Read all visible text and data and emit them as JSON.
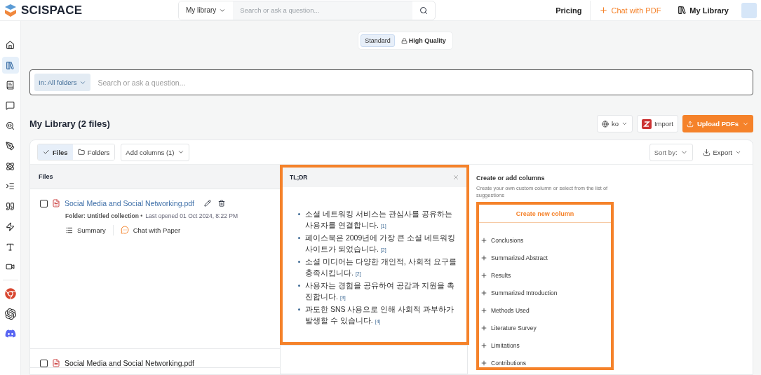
{
  "header": {
    "brand": "SCISPACE",
    "scope": "My library",
    "search_placeholder": "Search or ask a question...",
    "links": [
      {
        "label": "Pricing",
        "kind": "plain"
      },
      {
        "label": "Chat with PDF",
        "kind": "accent"
      },
      {
        "label": "My Library",
        "kind": "library"
      }
    ]
  },
  "sidebar": {
    "items": [
      {
        "selected": false
      },
      {
        "selected": true
      },
      {
        "selected": false
      },
      {
        "selected": false
      },
      {
        "selected": false
      },
      {
        "selected": false
      },
      {
        "selected": false
      },
      {
        "selected": false
      },
      {
        "selected": false
      },
      {
        "selected": false
      },
      {
        "selected": false
      },
      {
        "selected": false
      }
    ]
  },
  "modes": [
    {
      "label": "Standard",
      "selected": true,
      "locked": false
    },
    {
      "label": "High Quality",
      "selected": false,
      "locked": true
    }
  ],
  "library_search": {
    "scope_label": "In:",
    "scope": "All folders",
    "placeholder": "Search or ask a question..."
  },
  "title": "My Library (2 files)",
  "actions": {
    "language": "ko",
    "import": "Import",
    "upload": "Upload PDFs"
  },
  "toolbar": {
    "tabs": [
      {
        "label": "Files",
        "selected": true
      },
      {
        "label": "Folders",
        "selected": false
      }
    ],
    "add_columns": "Add columns (1)",
    "sort": "Sort by:",
    "export": "Export"
  },
  "table": {
    "columns": [
      "Files",
      "TL;DR"
    ],
    "tldr_highlighted": true,
    "rows": [
      {
        "file": "Social Media and Social Networking.pdf",
        "checked": false,
        "hovered": true,
        "folder": "Folder: Untitled collection •",
        "opened": "Last opened 01 Oct 2024, 8:22 PM",
        "actions": [
          "Summary",
          "Chat with Paper"
        ],
        "tldr": [
          {
            "text": "소셜 네트워킹 서비스는 관심사를 공유하는 사용자를 연결합니다.",
            "ref": "[1]"
          },
          {
            "text": "페이스북은 2009년에 가장 큰 소셜 네트워킹 사이트가 되었습니다.",
            "ref": "[2]"
          },
          {
            "text": "소셜 미디어는 다양한 개인적, 사회적 요구를 충족시킵니다.",
            "ref": "[2]"
          },
          {
            "text": "사용자는 경험을 공유하여 공감과 지원을 촉진합니다.",
            "ref": "[3]"
          },
          {
            "text": "과도한 SNS 사용으로 인해 사회적 과부하가 발생할 수 있습니다.",
            "ref": "[4]"
          }
        ]
      },
      {
        "file": "Social Media and Social Networking.pdf",
        "checked": false,
        "hovered": false
      }
    ]
  },
  "columns_panel": {
    "title": "Create or add columns",
    "hint": "Create your own custom column or select from the list of suggestions",
    "create": "Create new column",
    "highlighted": true,
    "suggestions": [
      "Conclusions",
      "Summarized Abstract",
      "Results",
      "Summarized Introduction",
      "Methods Used",
      "Literature Survey",
      "Limitations",
      "Contributions"
    ]
  }
}
